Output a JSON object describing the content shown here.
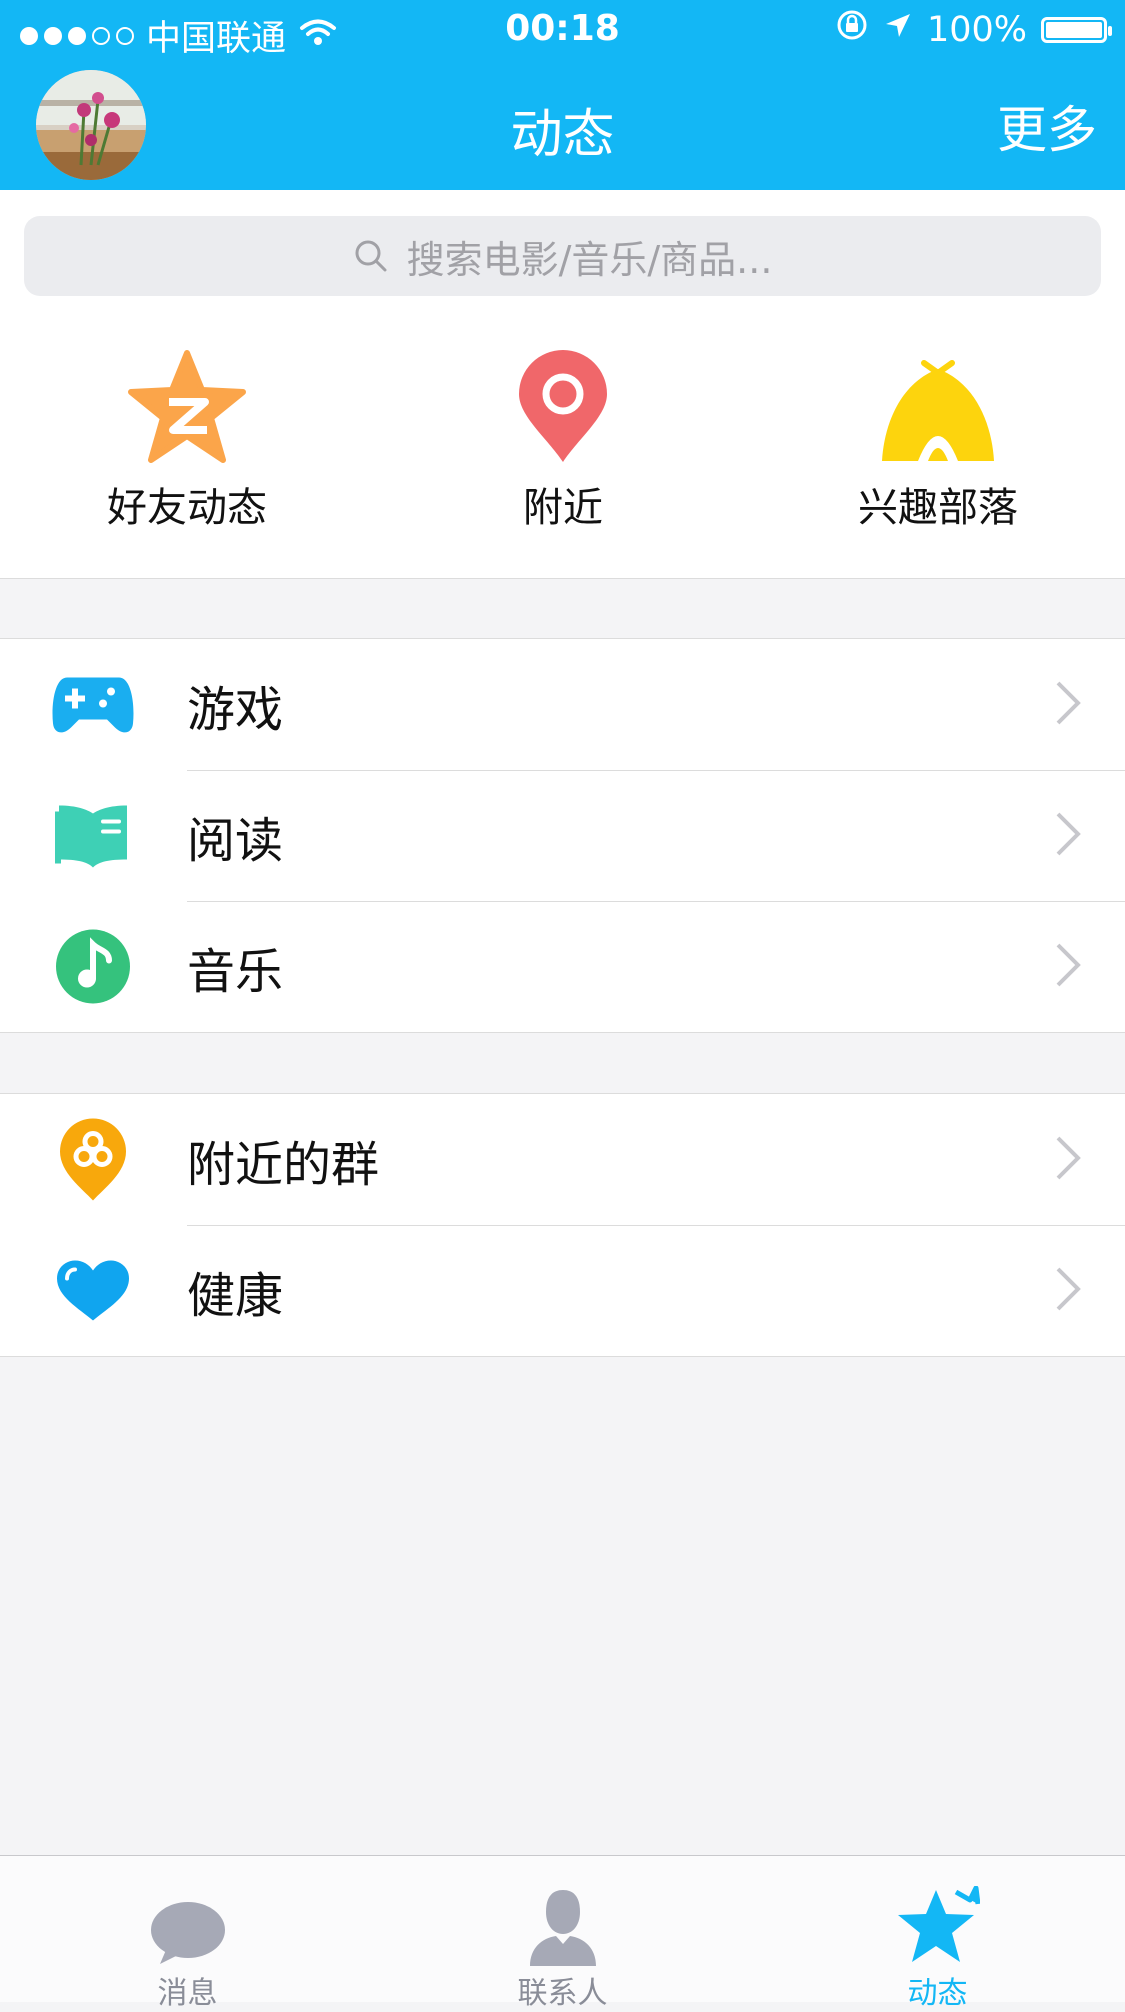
{
  "status_bar": {
    "carrier": "中国联通",
    "time": "00:18",
    "battery": "100%"
  },
  "nav": {
    "title": "动态",
    "more": "更多"
  },
  "search": {
    "placeholder": "搜索电影/音乐/商品..."
  },
  "features": [
    {
      "label": "好友动态",
      "icon": "qzone-star-icon",
      "color": "#fba54a"
    },
    {
      "label": "附近",
      "icon": "location-pin-icon",
      "color": "#f0676a"
    },
    {
      "label": "兴趣部落",
      "icon": "tent-icon",
      "color": "#fdd40d"
    }
  ],
  "group1": [
    {
      "label": "游戏",
      "icon": "gamepad-icon",
      "color": "#1aaef0"
    },
    {
      "label": "阅读",
      "icon": "book-icon",
      "color": "#3ed0b5"
    },
    {
      "label": "音乐",
      "icon": "music-note-icon",
      "color": "#35c27d"
    }
  ],
  "group2": [
    {
      "label": "附近的群",
      "icon": "nearby-group-icon",
      "color": "#f8a80c"
    },
    {
      "label": "健康",
      "icon": "heart-icon",
      "color": "#10a5ef"
    }
  ],
  "tabbar": [
    {
      "label": "消息",
      "icon": "chat-bubble-icon",
      "active": false
    },
    {
      "label": "联系人",
      "icon": "contact-person-icon",
      "active": false
    },
    {
      "label": "动态",
      "icon": "star-icon",
      "active": true
    }
  ],
  "colors": {
    "brand": "#13b7f5",
    "background": "#f4f4f6",
    "tab_inactive": "#8a8d98"
  }
}
